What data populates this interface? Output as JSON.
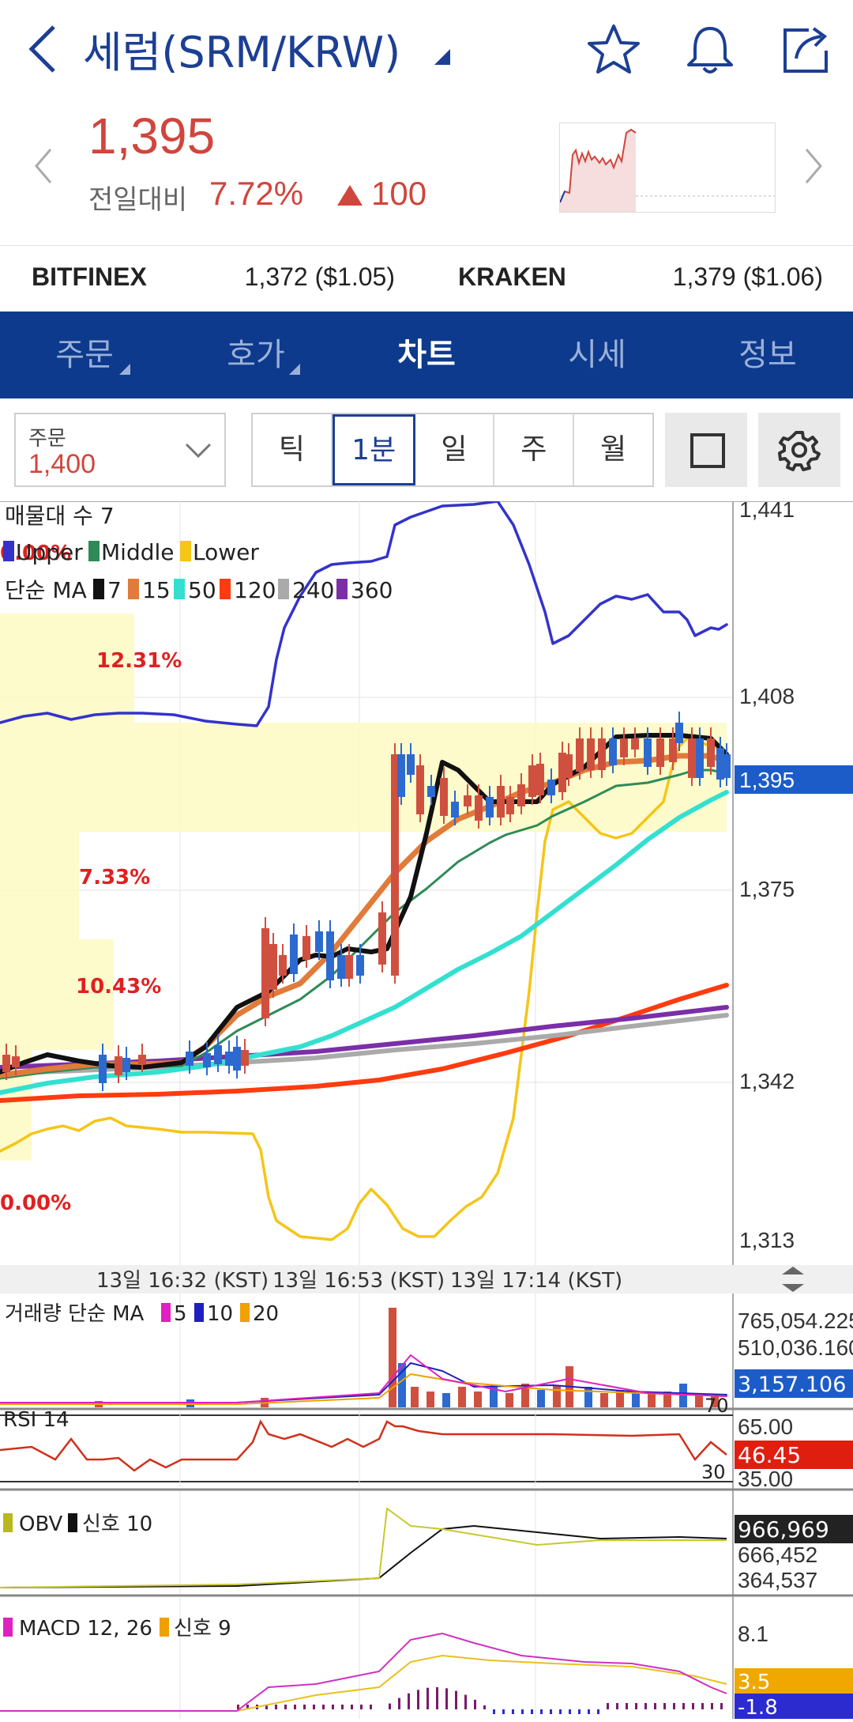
{
  "header": {
    "title": "세럼(SRM/KRW)",
    "icons": [
      "back-icon",
      "dropdown-caret-icon",
      "star-icon",
      "bell-icon",
      "share-icon"
    ]
  },
  "price": {
    "current": "1,395",
    "change_label": "전일대비",
    "change_pct": "7.72%",
    "change_abs": "100",
    "color_up": "#d0453c"
  },
  "exchanges": [
    {
      "name": "BITFINEX",
      "value": "1,372 ($1.05)"
    },
    {
      "name": "KRAKEN",
      "value": "1,379 ($1.06)"
    }
  ],
  "tabs": [
    {
      "label": "주문",
      "active": false,
      "corner": true
    },
    {
      "label": "호가",
      "active": false,
      "corner": true
    },
    {
      "label": "차트",
      "active": true,
      "corner": false
    },
    {
      "label": "시세",
      "active": false,
      "corner": false
    },
    {
      "label": "정보",
      "active": false,
      "corner": false
    }
  ],
  "toolbar": {
    "order_label": "주문",
    "order_value": "1,400",
    "intervals": [
      {
        "label": "틱",
        "active": false
      },
      {
        "label": "1분",
        "active": true
      },
      {
        "label": "일",
        "active": false
      },
      {
        "label": "주",
        "active": false
      },
      {
        "label": "월",
        "active": false
      }
    ]
  },
  "chart": {
    "legend_volume_profile": "매물대 수 7",
    "legend_bb": [
      {
        "name": "Upper",
        "color": "#3333cc"
      },
      {
        "name": "Middle",
        "color": "#2e8b57"
      },
      {
        "name": "Lower",
        "color": "#f5c518"
      }
    ],
    "legend_ma_label": "단순 MA",
    "legend_ma": [
      {
        "name": "7",
        "color": "#111111"
      },
      {
        "name": "15",
        "color": "#e07b3a"
      },
      {
        "name": "50",
        "color": "#33e0d0"
      },
      {
        "name": "120",
        "color": "#ff3b10"
      },
      {
        "name": "240",
        "color": "#aaaaaa"
      },
      {
        "name": "360",
        "color": "#7a2fa8"
      }
    ],
    "y_ticks": [
      "1,441",
      "1,408",
      "1,375",
      "1,342",
      "1,313"
    ],
    "current_price_tag": "1,395",
    "profile_pcts": [
      "0.00%",
      "12.31%",
      "7.33%",
      "10.43%",
      "0.00%"
    ],
    "time_labels": [
      "13일 16:32 (KST)",
      "13일 16:53 (KST)",
      "13일 17:14 (KST)"
    ],
    "volume_legend": "거래량 단순 MA",
    "volume_ma": [
      {
        "name": "5",
        "color": "#e020c0"
      },
      {
        "name": "10",
        "color": "#2020c0"
      },
      {
        "name": "20",
        "color": "#f0a000"
      }
    ],
    "volume_ticks": [
      "765,054.225",
      "510,036.160"
    ],
    "volume_tag": "3,157.106",
    "rsi_label": "RSI 14",
    "rsi_ticks": [
      "65.00",
      "35.00"
    ],
    "rsi_levels": [
      "70",
      "30"
    ],
    "rsi_tag": "46.45",
    "obv_label": "OBV",
    "obv_signal": "신호 10",
    "obv_ticks": [
      "666,452",
      "364,537"
    ],
    "obv_tag": "966,969",
    "macd_label": "MACD 12, 26",
    "macd_signal": "신호 9",
    "macd_ticks": [
      "8.1"
    ],
    "macd_tag1": "3.5",
    "macd_tag2": "-1.8"
  }
}
